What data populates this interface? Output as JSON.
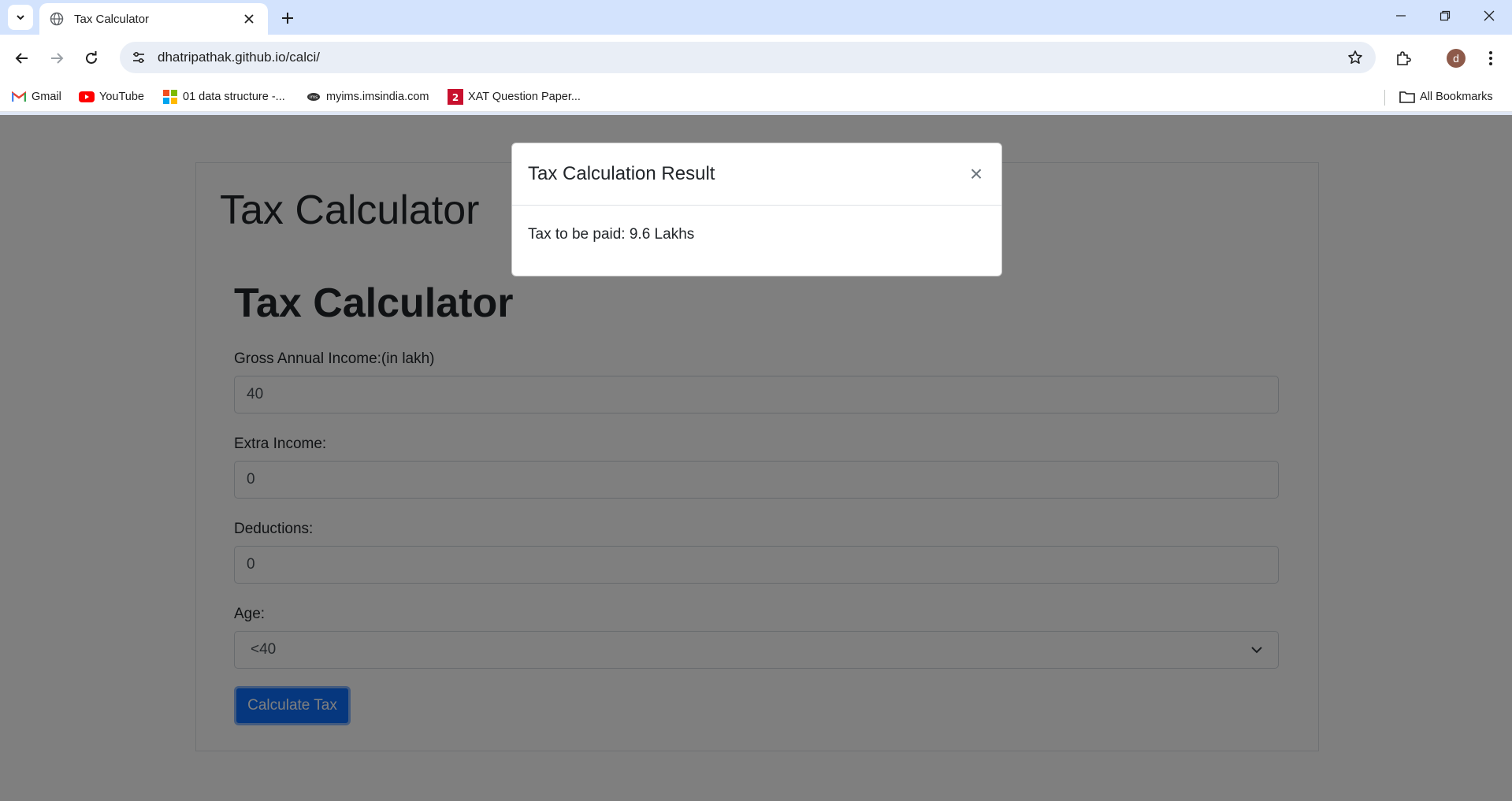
{
  "browser": {
    "tab_title": "Tax Calculator",
    "url": "dhatripathak.github.io/calci/",
    "profile_initial": "d",
    "bookmarks": [
      {
        "label": "Gmail",
        "icon": "gmail-icon"
      },
      {
        "label": "YouTube",
        "icon": "youtube-icon"
      },
      {
        "label": "01 data structure -...",
        "icon": "microsoft-icon"
      },
      {
        "label": "myims.imsindia.com",
        "icon": "ims-icon"
      },
      {
        "label": "XAT Question Paper...",
        "icon": "xat-icon"
      }
    ],
    "all_bookmarks": "All Bookmarks"
  },
  "page": {
    "heading": "Tax Calculator",
    "form_heading": "Tax Calculator",
    "fields": {
      "gross_income": {
        "label": "Gross Annual Income:(in lakh)",
        "value": "40"
      },
      "extra_income": {
        "label": "Extra Income:",
        "value": "0"
      },
      "deductions": {
        "label": "Deductions:",
        "value": "0"
      },
      "age": {
        "label": "Age:",
        "value": "<40"
      }
    },
    "submit_label": "Calculate Tax"
  },
  "modal": {
    "title": "Tax Calculation Result",
    "close": "×",
    "body": "Tax to be paid: 9.6 Lakhs"
  },
  "colors": {
    "primary": "#0d6efd",
    "tabstrip": "#d3e3fd"
  }
}
